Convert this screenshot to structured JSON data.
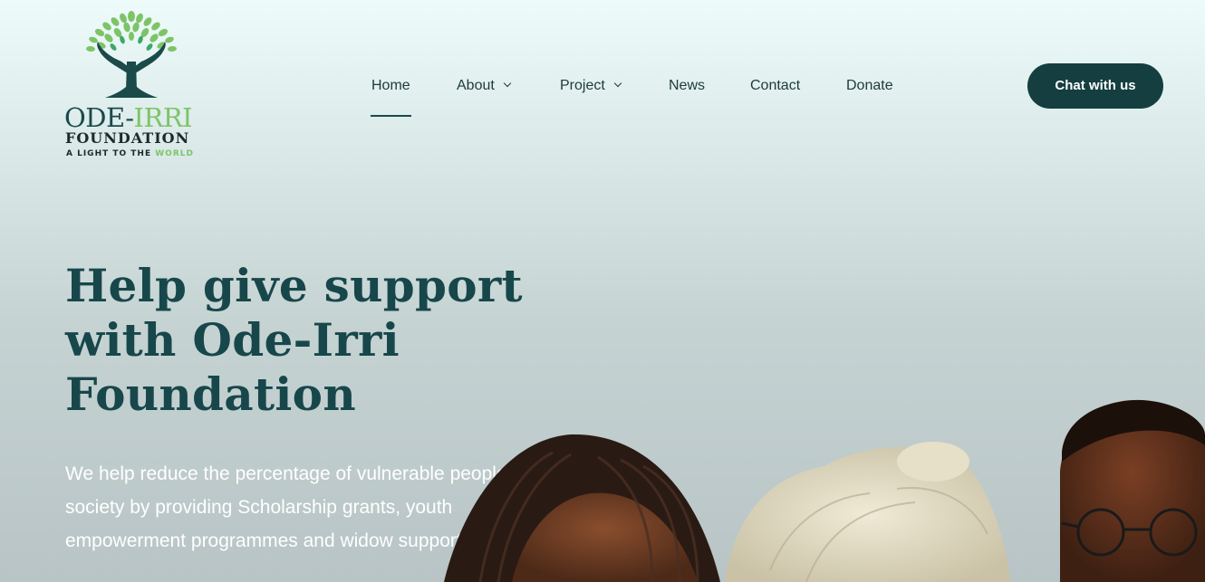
{
  "logo": {
    "name_part1": "ODE-",
    "name_part2": "IRRI",
    "subtitle": "FOUNDATION",
    "tagline_part1": "A LIGHT TO THE ",
    "tagline_part2": "WORLD",
    "icon": "tree-hands-icon",
    "colors": {
      "dark": "#1a4a4a",
      "green": "#7dc468"
    }
  },
  "nav": {
    "items": [
      {
        "label": "Home",
        "active": true,
        "has_dropdown": false
      },
      {
        "label": "About",
        "active": false,
        "has_dropdown": true
      },
      {
        "label": "Project",
        "active": false,
        "has_dropdown": true
      },
      {
        "label": "News",
        "active": false,
        "has_dropdown": false
      },
      {
        "label": "Contact",
        "active": false,
        "has_dropdown": false
      },
      {
        "label": "Donate",
        "active": false,
        "has_dropdown": false
      }
    ],
    "dropdown_icon": "chevron-down-icon",
    "cta_label": "Chat with us"
  },
  "hero": {
    "title": "Help give support with Ode-Irri Foundation",
    "description": "We help reduce the percentage of vulnerable people in society by providing Scholarship grants, youth empowerment programmes and widow support"
  },
  "colors": {
    "primary": "#153e40",
    "title": "#17474a",
    "accent_green": "#7dc468",
    "nav_text": "#1f3a3a"
  }
}
